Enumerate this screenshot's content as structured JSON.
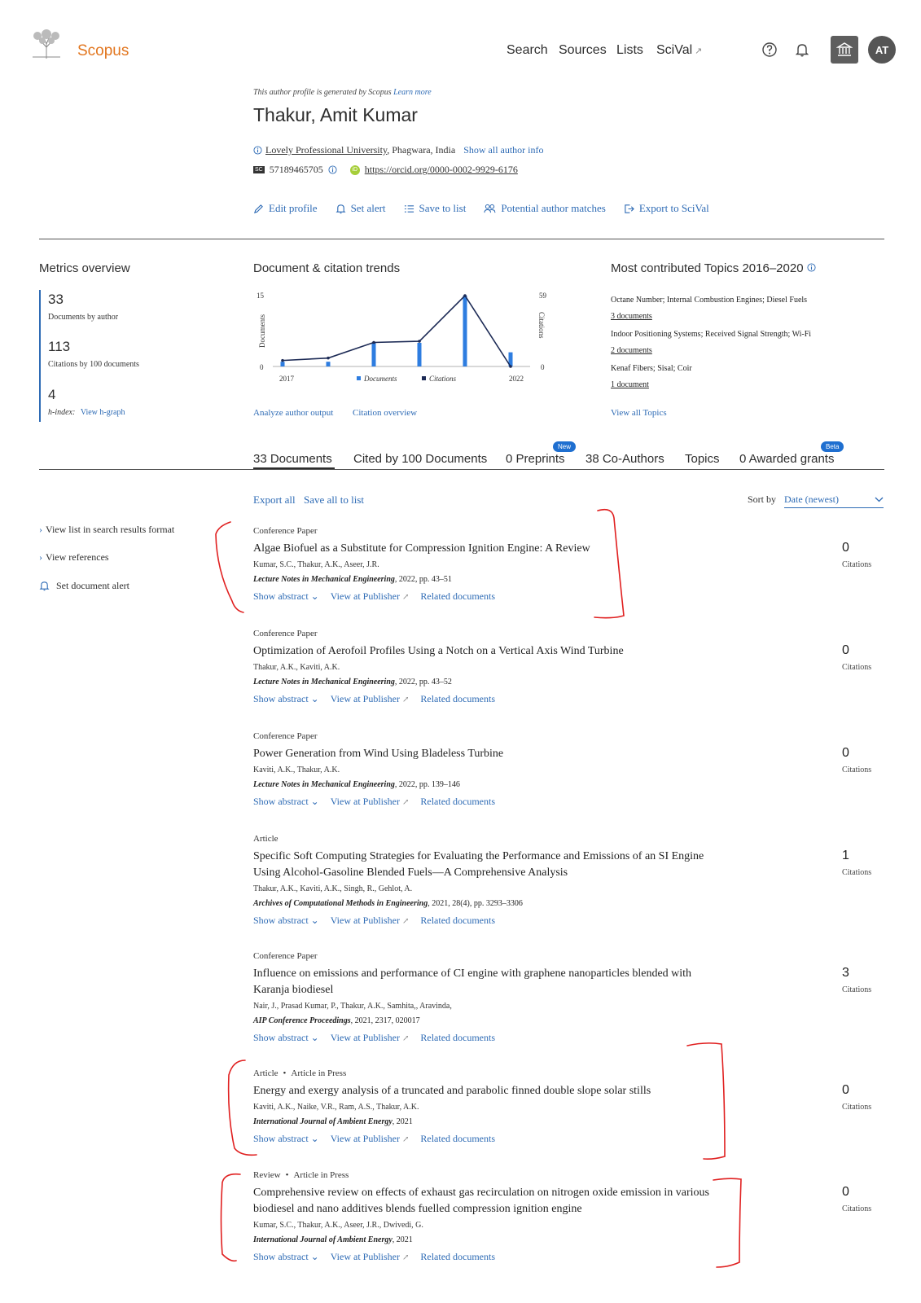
{
  "header": {
    "brand": "Scopus",
    "nav": [
      "Search",
      "Sources",
      "Lists",
      "SciVal"
    ],
    "scival_ext": "↗",
    "avatar_initials": "AT"
  },
  "profile": {
    "note_prefix": "This author profile is generated by Scopus",
    "note_link": "Learn more",
    "name": "Thakur, Amit Kumar",
    "affiliation_name": "Lovely Professional University",
    "affiliation_loc": ", Phagwara, India",
    "show_info": "Show all author info",
    "scopus_badge": "SC",
    "scopus_id": "57189465705",
    "orcid_badge": "iD",
    "orcid_url": "https://orcid.org/0000-0002-9929-6176",
    "actions": [
      "Edit profile",
      "Set alert",
      "Save to list",
      "Potential author matches",
      "Export to SciVal"
    ]
  },
  "metrics": {
    "title": "Metrics overview",
    "documents": "33",
    "documents_label": "Documents by author",
    "citations": "113",
    "citations_label": "Citations by 100 documents",
    "hindex": "4",
    "hindex_label": "h-index:",
    "hindex_link": "View h-graph"
  },
  "trends": {
    "title": "Document & citation trends",
    "left_axis_label": "Documents",
    "right_axis_label": "Citations",
    "left_max": "15",
    "right_max": "59",
    "left_min": "0",
    "right_min": "0",
    "x_start": "2017",
    "x_end": "2022",
    "legend_docs": "Documents",
    "legend_cites": "Citations",
    "link_analyze": "Analyze author output",
    "link_citation": "Citation overview"
  },
  "chart_data": {
    "type": "bar",
    "categories": [
      "2017",
      "2018",
      "2019",
      "2020",
      "2021",
      "2022"
    ],
    "series": [
      {
        "name": "Documents",
        "type": "bar",
        "axis": "left",
        "values": [
          1,
          1,
          5,
          5,
          15,
          3
        ]
      },
      {
        "name": "Citations",
        "type": "line",
        "axis": "right",
        "values": [
          5,
          7,
          20,
          21,
          59,
          0
        ]
      }
    ],
    "ylim_left": [
      0,
      15
    ],
    "ylim_right": [
      0,
      59
    ],
    "xlabel_start": "2017",
    "xlabel_end": "2022"
  },
  "topics": {
    "title": "Most contributed Topics 2016–2020",
    "items": [
      {
        "name": "Octane Number; Internal Combustion Engines; Diesel Fuels",
        "docs": "3 documents"
      },
      {
        "name": "Indoor Positioning Systems; Received Signal Strength; Wi-Fi",
        "docs": "2 documents"
      },
      {
        "name": "Kenaf Fibers; Sisal; Coir",
        "docs": "1 document"
      }
    ],
    "view_all": "View all Topics"
  },
  "tabs": {
    "items": [
      "33 Documents",
      "Cited by 100 Documents",
      "0 Preprints",
      "38 Co-Authors",
      "Topics",
      "0 Awarded grants"
    ],
    "new_badge": "New",
    "beta_badge": "Beta"
  },
  "list": {
    "export_all": "Export all",
    "save_all": "Save all to list",
    "sort_label": "Sort by",
    "sort_value": "Date (newest)"
  },
  "sidebar": {
    "items": [
      "View list in search results format",
      "View references",
      "Set document alert"
    ]
  },
  "doc_links": {
    "abstract": "Show abstract",
    "publisher": "View at Publisher",
    "related": "Related documents",
    "citations_label": "Citations"
  },
  "documents": [
    {
      "type": "Conference Paper",
      "title": "Algae Biofuel as a Substitute for Compression Ignition Engine: A Review",
      "authors": "Kumar, S.C., Thakur, A.K., Aseer, J.R.",
      "journal": "Lecture Notes in Mechanical Engineering",
      "details": ", 2022, pp. 43–51",
      "citations": "0"
    },
    {
      "type": "Conference Paper",
      "title": "Optimization of Aerofoil Profiles Using a Notch on a Vertical Axis Wind Turbine",
      "authors": "Thakur, A.K., Kaviti, A.K.",
      "journal": "Lecture Notes in Mechanical Engineering",
      "details": ", 2022, pp. 43–52",
      "citations": "0"
    },
    {
      "type": "Conference Paper",
      "title": "Power Generation from Wind Using Bladeless Turbine",
      "authors": "Kaviti, A.K., Thakur, A.K.",
      "journal": "Lecture Notes in Mechanical Engineering",
      "details": ", 2022, pp. 139–146",
      "citations": "0"
    },
    {
      "type": "Article",
      "title": "Specific Soft Computing Strategies for Evaluating the Performance and Emissions of an SI Engine Using Alcohol-Gasoline Blended Fuels—A Comprehensive Analysis",
      "authors": "Thakur, A.K., Kaviti, A.K., Singh, R., Gehlot, A.",
      "journal": "Archives of Computational Methods in Engineering",
      "details": ", 2021, 28(4), pp. 3293–3306",
      "citations": "1"
    },
    {
      "type": "Conference Paper",
      "title": "Influence on emissions and performance of CI engine with graphene nanoparticles blended with Karanja biodiesel",
      "authors": "Nair, J., Prasad Kumar, P., Thakur, A.K., Samhita,, Aravinda,",
      "journal": "AIP Conference Proceedings",
      "details": ", 2021, 2317, 020017",
      "citations": "3"
    },
    {
      "type": "Article",
      "subtype": "Article in Press",
      "title": "Energy and exergy analysis of a truncated and parabolic finned double slope solar stills",
      "authors": "Kaviti, A.K., Naike, V.R., Ram, A.S., Thakur, A.K.",
      "journal": "International Journal of Ambient Energy",
      "details": ", 2021",
      "citations": "0"
    },
    {
      "type": "Review",
      "subtype": "Article in Press",
      "title": "Comprehensive review on effects of exhaust gas recirculation on nitrogen oxide emission in various biodiesel and nano additives blends fuelled compression ignition engine",
      "authors": "Kumar, S.C., Thakur, A.K., Aseer, J.R., Dwivedi, G.",
      "journal": "International Journal of Ambient Energy",
      "details": ", 2021",
      "citations": "0"
    }
  ]
}
